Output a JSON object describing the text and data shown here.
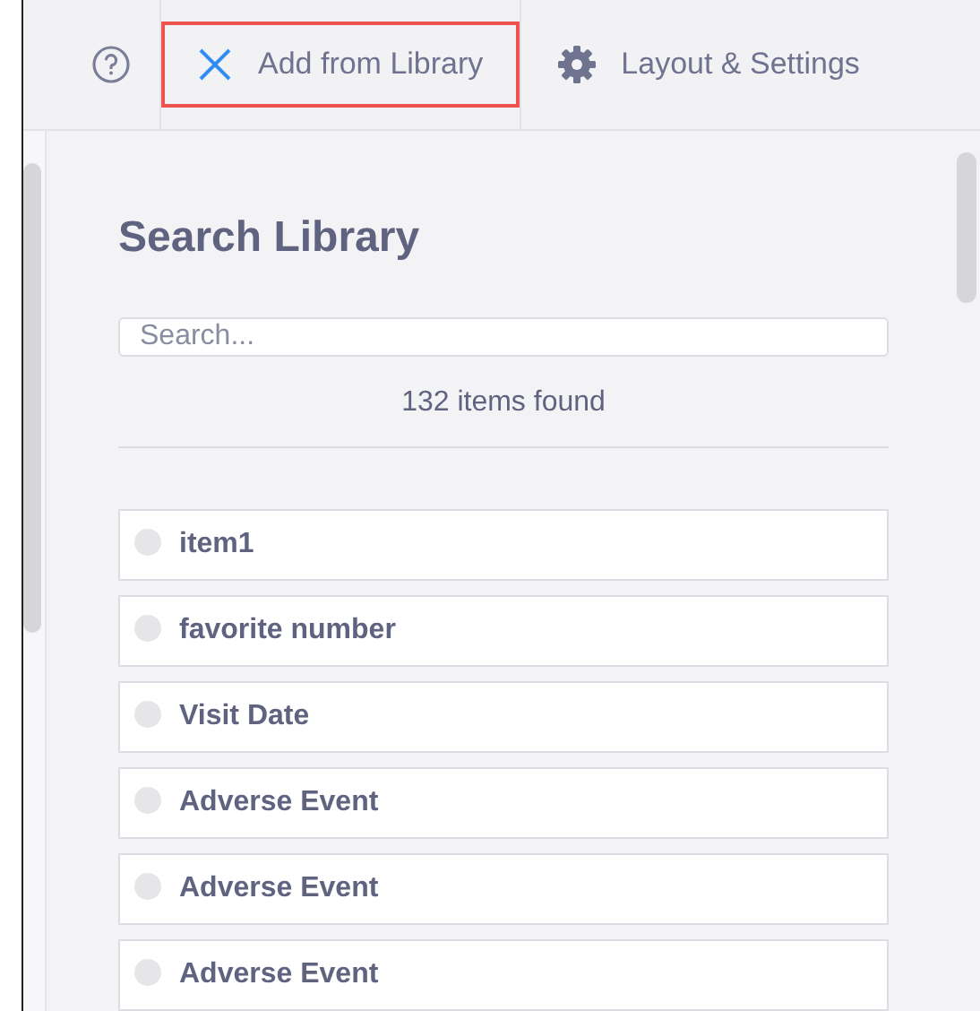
{
  "tabs": [
    {
      "kind": "help",
      "selected": false
    },
    {
      "kind": "close",
      "label": "Add from Library",
      "selected": true
    },
    {
      "kind": "settings",
      "label": "Layout & Settings",
      "selected": false
    }
  ],
  "library": {
    "title": "Search Library",
    "search": {
      "placeholder": "Search..."
    },
    "count": "132 items found",
    "items": [
      {
        "label": "item1",
        "selected": false
      },
      {
        "label": "favorite number",
        "selected": false
      },
      {
        "label": "Visit Date",
        "selected": false
      },
      {
        "label": "Adverse Event",
        "selected": false
      },
      {
        "label": "Adverse Event",
        "selected": false
      },
      {
        "label": "Adverse Event",
        "selected": false
      }
    ]
  }
}
